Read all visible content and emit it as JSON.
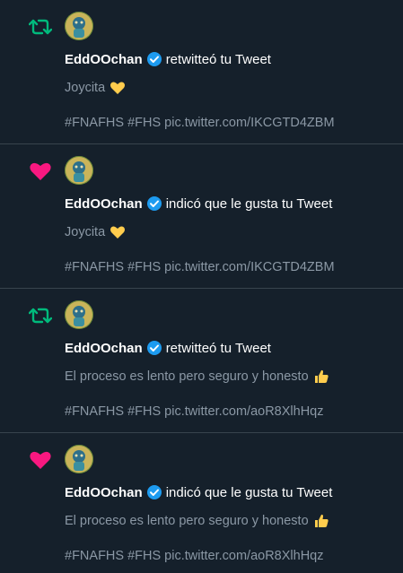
{
  "colors": {
    "background": "#15202b",
    "divider": "#38444d",
    "retweet": "#00ba7c",
    "like": "#f91880",
    "verified": "#1d9bf0",
    "text_primary": "#ffffff",
    "text_secondary": "#8b98a5"
  },
  "notifications": [
    {
      "type": "retweet",
      "icon": "retweet-icon",
      "username": "EddOOchan",
      "action": "retwitteó tu Tweet",
      "text": "Joycita",
      "emoji": "yellow-heart-emoji",
      "links": "#FNAFHS #FHS pic.twitter.com/IKCGTD4ZBM"
    },
    {
      "type": "like",
      "icon": "heart-icon",
      "username": "EddOOchan",
      "action": "indicó que le gusta tu Tweet",
      "text": "Joycita",
      "emoji": "yellow-heart-emoji",
      "links": "#FNAFHS #FHS pic.twitter.com/IKCGTD4ZBM"
    },
    {
      "type": "retweet",
      "icon": "retweet-icon",
      "username": "EddOOchan",
      "action": "retwitteó tu Tweet",
      "text": "El proceso es lento pero seguro y honesto",
      "emoji": "thumbs-up-emoji",
      "links": "#FNAFHS #FHS pic.twitter.com/aoR8XlhHqz"
    },
    {
      "type": "like",
      "icon": "heart-icon",
      "username": "EddOOchan",
      "action": "indicó que le gusta tu Tweet",
      "text": "El proceso es lento pero seguro y honesto",
      "emoji": "thumbs-up-emoji",
      "links": "#FNAFHS #FHS pic.twitter.com/aoR8XlhHqz"
    }
  ]
}
